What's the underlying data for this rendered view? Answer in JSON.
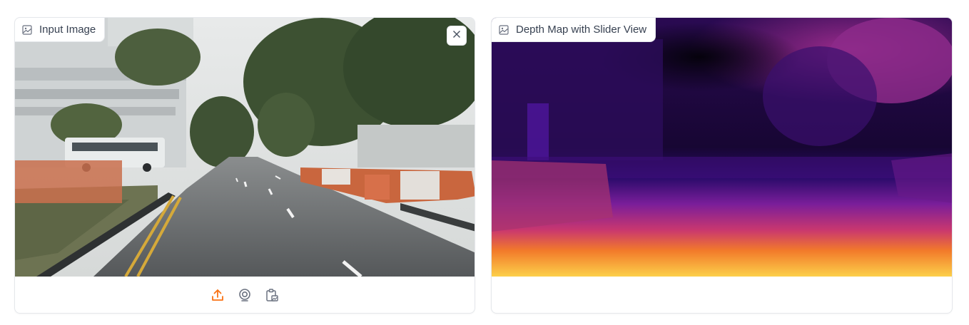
{
  "input_panel": {
    "label": "Input Image",
    "label_icon": "image-icon",
    "close_icon": "close-icon",
    "toolbar": [
      {
        "name": "upload-button",
        "icon": "upload-icon",
        "color": "#f97316"
      },
      {
        "name": "webcam-button",
        "icon": "webcam-icon",
        "color": "#6b7280"
      },
      {
        "name": "clipboard-button",
        "icon": "clipboard-icon",
        "color": "#6b7280"
      }
    ]
  },
  "output_panel": {
    "label": "Depth Map with Slider View",
    "label_icon": "image-icon"
  },
  "colors": {
    "accent": "#f97316",
    "border": "#e5e7eb",
    "text": "#374151"
  }
}
